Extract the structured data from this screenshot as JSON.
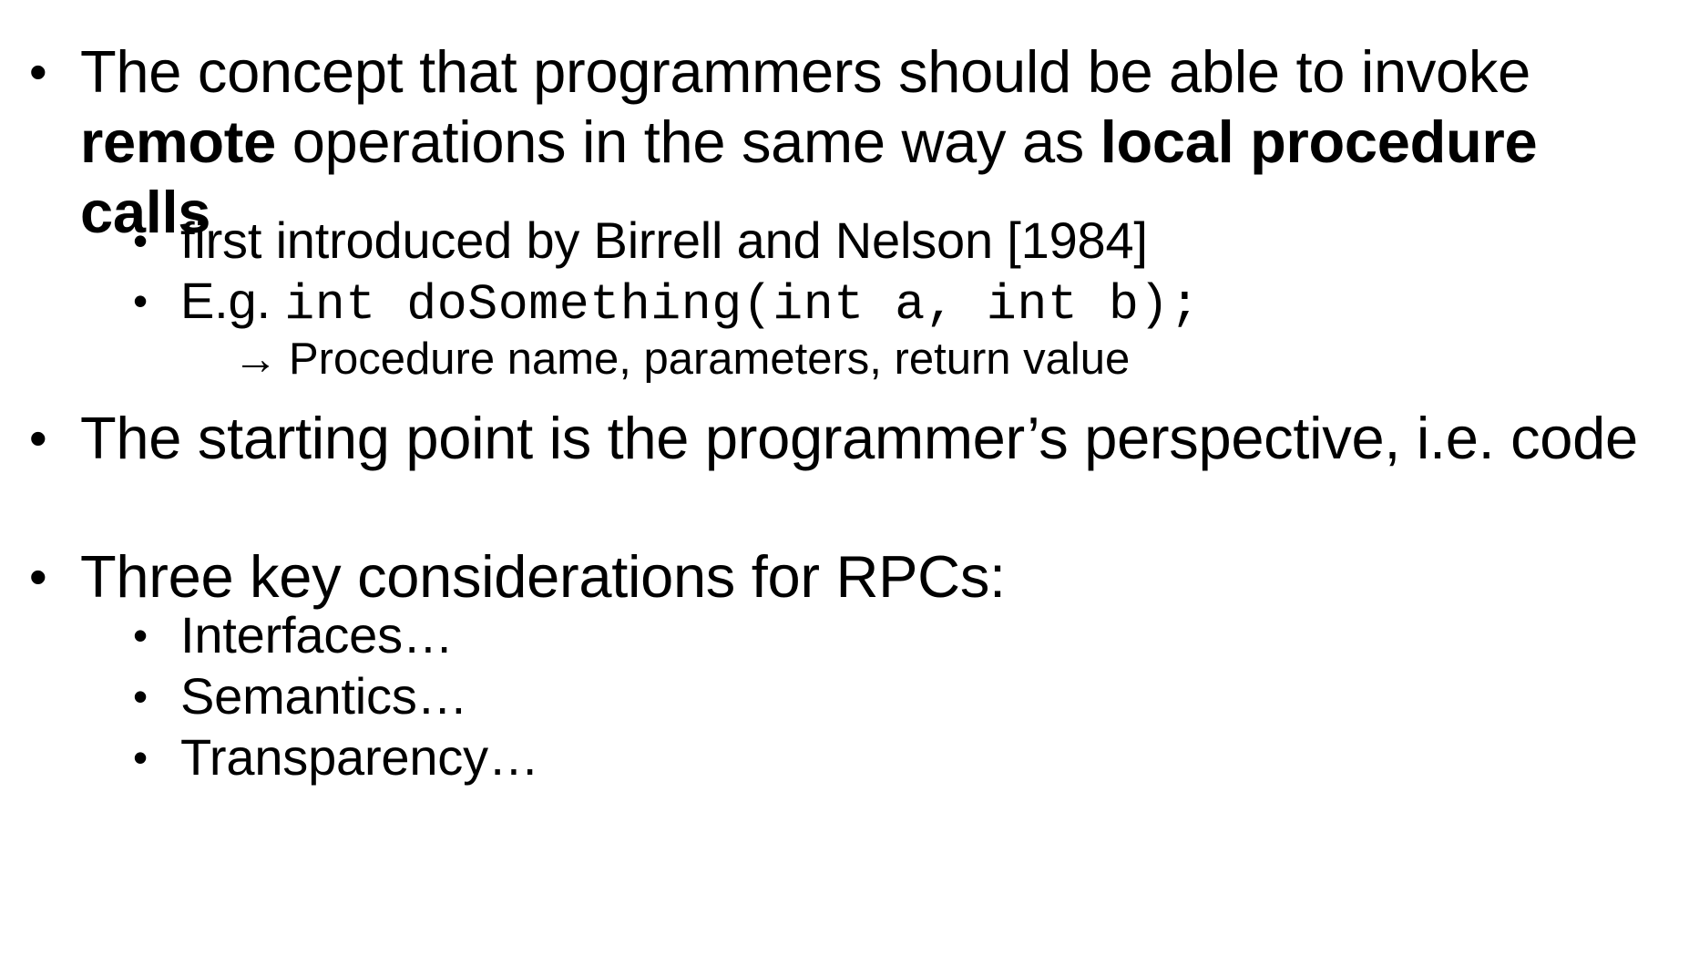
{
  "bullets": {
    "b1": {
      "part1": "The concept that programmers should be able to invoke ",
      "bold1": "remote",
      "part2": " operations in the same way as ",
      "bold2": "local procedure calls"
    },
    "b1_sub1": "first introduced by Birrell and Nelson [1984]",
    "b1_sub2_prefix": "E.g. ",
    "b1_sub2_code": "int doSomething(int a, int b);",
    "b1_sub2_detail_arrow": "→",
    "b1_sub2_detail": "Procedure name, parameters, return value",
    "b2": "The starting point is the programmer’s perspective, i.e. code",
    "b3": "Three key considerations for RPCs:",
    "b3_subs": [
      "Interfaces…",
      "Semantics…",
      "Transparency…"
    ]
  },
  "bullet_glyph": "•"
}
